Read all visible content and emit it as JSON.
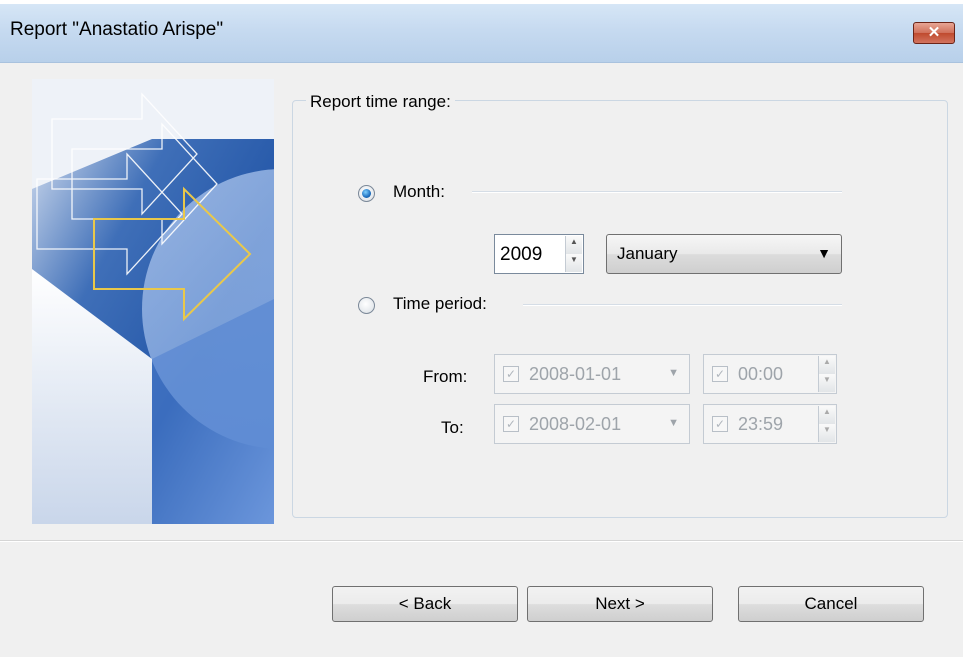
{
  "window": {
    "title": "Report \"Anastatio Arispe\"",
    "close_glyph": "✕"
  },
  "group": {
    "title": "Report time range:"
  },
  "month_option": {
    "label": "Month:",
    "selected": true
  },
  "year": {
    "value": "2009"
  },
  "month_select": {
    "value": "January"
  },
  "period_option": {
    "label": "Time period:",
    "selected": false
  },
  "from": {
    "label": "From:",
    "date": "2008-01-01",
    "time": "00:00"
  },
  "to": {
    "label": "To:",
    "date": "2008-02-01",
    "time": "23:59"
  },
  "buttons": {
    "back": "< Back",
    "next": "Next >",
    "cancel": "Cancel"
  },
  "icons": {
    "spin_up": "▲",
    "spin_down": "▼",
    "dropdown": "▼",
    "check": "✓"
  }
}
